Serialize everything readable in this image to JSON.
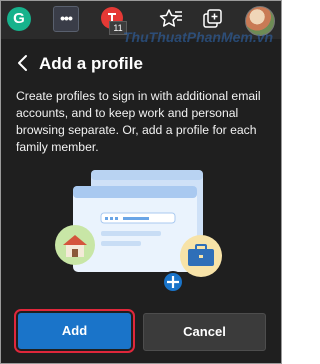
{
  "toolbar": {
    "extension_badge": "11",
    "grammarly_letter": "G",
    "more_label": "•••"
  },
  "watermark": "ThuThuatPhanMem.vn",
  "panel": {
    "title": "Add a profile",
    "description": "Create profiles to sign in with additional email accounts, and to keep work and personal browsing separate. Or, add a profile for each family member."
  },
  "actions": {
    "add_label": "Add",
    "cancel_label": "Cancel"
  },
  "colors": {
    "background": "#1f1f1f",
    "primary_button": "#1a74c9",
    "highlight_outline": "#e0273b"
  },
  "icons": [
    "grammarly-icon",
    "more-icon",
    "extension-icon",
    "favorites-icon",
    "collections-icon",
    "profile-avatar-icon",
    "back-arrow-icon",
    "house-icon",
    "briefcase-icon",
    "plus-icon"
  ]
}
